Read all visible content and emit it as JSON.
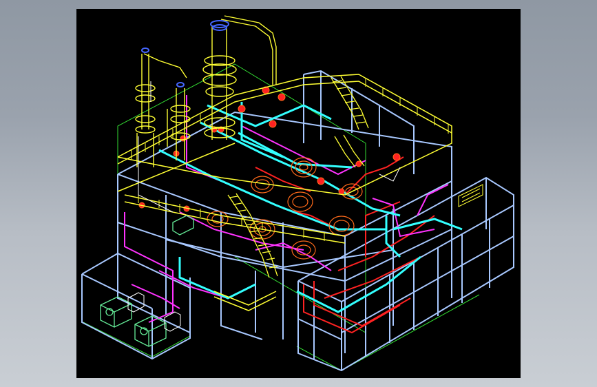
{
  "viewer": {
    "background": "#000000",
    "frame_background": "#a0a8b2",
    "layer_colors": {
      "steel_frame": "#a8c8ff",
      "platforms_ladders": "#ffff33",
      "main_pipes": "#33ffff",
      "process_lines": "#ff33ff",
      "red_pipes": "#ff2222",
      "coils": "#ff6a1a",
      "ground_outline": "#33dd33",
      "pumps": "#66ee99",
      "white_lines": "#ffffff",
      "vessel_caps": "#4466ff"
    }
  }
}
